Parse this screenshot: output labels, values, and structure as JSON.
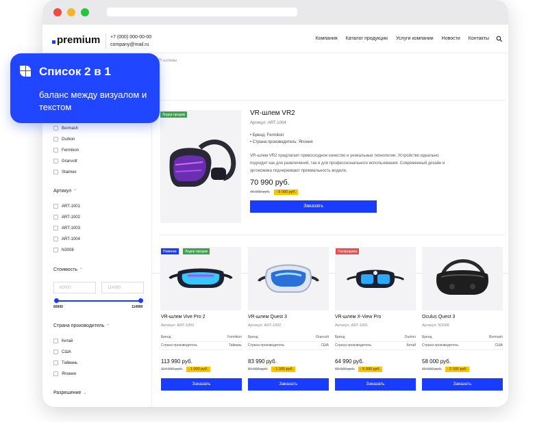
{
  "header": {
    "logo": "premium",
    "phone": "+7 (000) 000-00-00",
    "email": "company@mail.ru",
    "nav": [
      "Компания",
      "Каталог продукции",
      "Услуги компании",
      "Новости",
      "Контакты"
    ]
  },
  "breadcrumb": "VR-шлемы",
  "callout": {
    "title": "Список 2 в 1",
    "subtitle": "баланс между визуалом и текстом"
  },
  "sidebar": {
    "brands": [
      "Bormash",
      "Durkon",
      "Fermikon",
      "Granvolt",
      "Staimex"
    ],
    "sku_title": "Артикул",
    "skus": [
      "ART-1001",
      "ART-1002",
      "ART-1003",
      "ART-1004",
      "N3008"
    ],
    "price_title": "Стоимость",
    "price_min_placeholder": "60000",
    "price_max_placeholder": "114990",
    "price_min": "60000",
    "price_max": "114990",
    "country_title": "Страна производитель",
    "countries": [
      "Китай",
      "США",
      "Тайвань",
      "Япония"
    ],
    "resolution_title": "Разрешение"
  },
  "hero": {
    "badge": "Лидер продаж",
    "title": "VR-шлем VR2",
    "sku": "Артикул: ART-1004",
    "brand": "Бренд: Fermikon",
    "country": "Страна производитель: Япония",
    "description": "VR-шлем VR2 предлагает превосходное качество и уникальные технологии. Устройство идеально подходит как для развлечений, так и для профессионального использования. Современный дизайн и эргономика подчеркивают премиальность модели.",
    "price": "70 990 руб.",
    "old_price": "75 990 руб.",
    "discount": "- 5 000 руб.",
    "button": "Заказать"
  },
  "labels": {
    "brand": "Бренд",
    "country": "Страна производитель"
  },
  "products": [
    {
      "badges": [
        "Новинка",
        "Лидер продаж"
      ],
      "title": "VR-шлем Vive Pro 2",
      "sku": "Артикул: ART-1003",
      "brand": "Fermikon",
      "country": "Тайвань",
      "price": "113 990 руб.",
      "old_price": "114 990 руб.",
      "discount": "- 1 000 руб.",
      "button": "Заказать"
    },
    {
      "badges": [],
      "title": "VR-шлем Quest 3",
      "sku": "Артикул: ART-1002",
      "brand": "Granvolt",
      "country": "США",
      "price": "83 990 руб.",
      "old_price": "84 990 руб.",
      "discount": "- 1 000 руб.",
      "button": "Заказать"
    },
    {
      "badges": [
        "Распродажа"
      ],
      "title": "VR-шлем X-View Pro",
      "sku": "Артикул: ART-1001",
      "brand": "Durkon",
      "country": "Китай",
      "price": "64 990 руб.",
      "old_price": "69 990 руб.",
      "discount": "- 5 000 руб.",
      "button": "Заказать"
    },
    {
      "badges": [],
      "title": "Oculus Quest 3",
      "sku": "Артикул: N3008",
      "brand": "Bormash",
      "country": "США",
      "price": "58 000 руб.",
      "old_price": "60 000 руб.",
      "discount": "- 2 000 руб.",
      "button": "Заказать"
    }
  ]
}
